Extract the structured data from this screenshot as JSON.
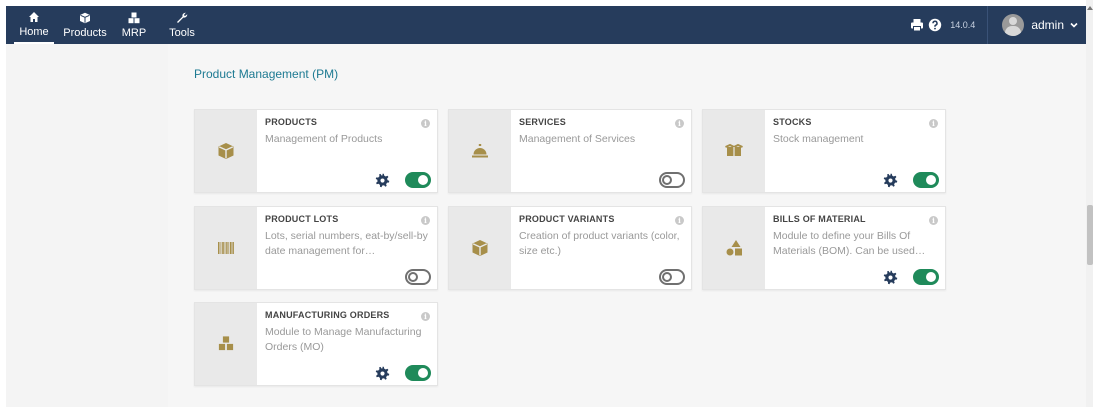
{
  "nav": {
    "items": [
      {
        "label": "Home",
        "icon": "home-icon"
      },
      {
        "label": "Products",
        "icon": "cube-icon"
      },
      {
        "label": "MRP",
        "icon": "cubes-icon"
      },
      {
        "label": "Tools",
        "icon": "wrench-icon"
      }
    ]
  },
  "header": {
    "version": "14.0.4",
    "username": "admin"
  },
  "section": {
    "title": "Product Management (PM)"
  },
  "cards": [
    {
      "title": "PRODUCTS",
      "desc": "Management of Products",
      "enabled": true,
      "settings": true,
      "icon": "cube-icon"
    },
    {
      "title": "SERVICES",
      "desc": "Management of Services",
      "enabled": false,
      "settings": false,
      "icon": "concierge-bell-icon"
    },
    {
      "title": "STOCKS",
      "desc": "Stock management",
      "enabled": true,
      "settings": true,
      "icon": "boxes-icon"
    },
    {
      "title": "PRODUCT LOTS",
      "desc": "Lots, serial numbers, eat-by/sell-by date management for…",
      "enabled": false,
      "settings": false,
      "icon": "barcode-icon"
    },
    {
      "title": "PRODUCT VARIANTS",
      "desc": "Creation of product variants (color, size etc.)",
      "enabled": false,
      "settings": false,
      "icon": "cube-icon"
    },
    {
      "title": "BILLS OF MATERIAL",
      "desc": "Module to define your Bills Of Materials (BOM). Can be used…",
      "enabled": true,
      "settings": true,
      "icon": "shapes-icon"
    },
    {
      "title": "MANUFACTURING ORDERS",
      "desc": "Module to Manage Manufacturing Orders (MO)",
      "enabled": true,
      "settings": true,
      "icon": "cubes-icon"
    }
  ],
  "colors": {
    "topbar": "#263c5c",
    "accent_title": "#1d7a92",
    "toggle_on": "#1f8a5a",
    "gear": "#263c5c",
    "icon_gold": "#a78f4a"
  }
}
